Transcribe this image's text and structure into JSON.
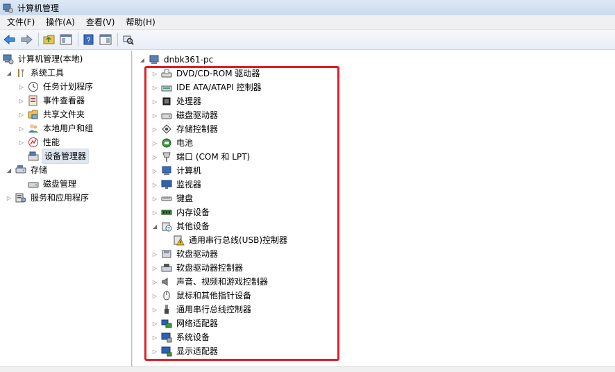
{
  "window": {
    "title": "计算机管理"
  },
  "menu": {
    "file": "文件(F)",
    "action": "操作(A)",
    "view": "查看(V)",
    "help": "帮助(H)"
  },
  "left_tree": {
    "root": "计算机管理(本地)",
    "system_tools": "系统工具",
    "task_scheduler": "任务计划程序",
    "event_viewer": "事件查看器",
    "shared_folders": "共享文件夹",
    "local_users": "本地用户和组",
    "performance": "性能",
    "device_manager": "设备管理器",
    "storage": "存储",
    "disk_management": "磁盘管理",
    "services_apps": "服务和应用程序"
  },
  "device_tree": {
    "computer_name": "dnbk361-pc",
    "categories": [
      {
        "label": "DVD/CD-ROM 驱动器",
        "icon": "dvd-drive-icon"
      },
      {
        "label": "IDE ATA/ATAPI 控制器",
        "icon": "ide-controller-icon"
      },
      {
        "label": "处理器",
        "icon": "processor-icon"
      },
      {
        "label": "磁盘驱动器",
        "icon": "disk-drive-icon"
      },
      {
        "label": "存储控制器",
        "icon": "storage-controller-icon"
      },
      {
        "label": "电池",
        "icon": "battery-icon"
      },
      {
        "label": "端口 (COM 和 LPT)",
        "icon": "port-icon"
      },
      {
        "label": "计算机",
        "icon": "computer-icon"
      },
      {
        "label": "监视器",
        "icon": "monitor-icon"
      },
      {
        "label": "键盘",
        "icon": "keyboard-icon"
      },
      {
        "label": "内存设备",
        "icon": "memory-icon"
      },
      {
        "label": "其他设备",
        "icon": "other-devices-icon"
      },
      {
        "label": "软盘驱动器",
        "icon": "floppy-drive-icon"
      },
      {
        "label": "软盘驱动器控制器",
        "icon": "floppy-controller-icon"
      },
      {
        "label": "声音、视频和游戏控制器",
        "icon": "sound-icon"
      },
      {
        "label": "鼠标和其他指针设备",
        "icon": "mouse-icon"
      },
      {
        "label": "通用串行总线控制器",
        "icon": "usb-icon"
      },
      {
        "label": "网络适配器",
        "icon": "network-adapter-icon"
      },
      {
        "label": "系统设备",
        "icon": "system-devices-icon"
      },
      {
        "label": "显示适配器",
        "icon": "display-adapter-icon"
      }
    ],
    "other_device_child": {
      "label": "通用串行总线(USB)控制器",
      "icon": "warning-icon"
    }
  },
  "colors": {
    "highlight_border": "#e01f26",
    "selection": "#dfe6ef"
  }
}
